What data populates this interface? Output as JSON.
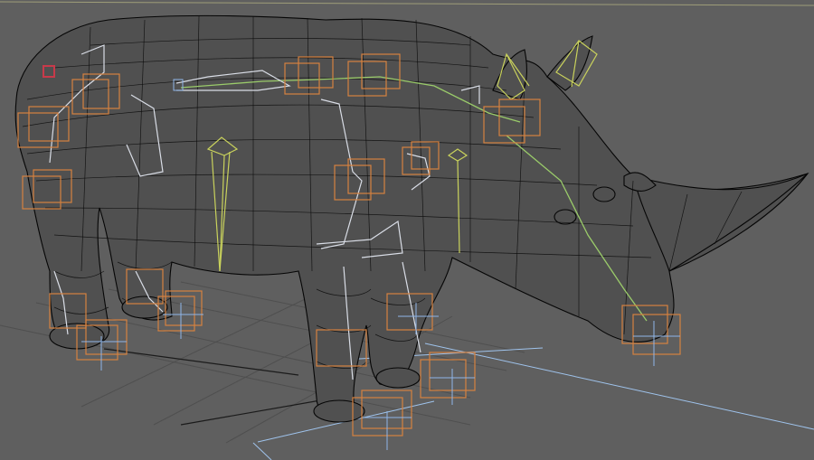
{
  "viewport": {
    "background_color": "#5f5f5f",
    "view_mode": "wireframe",
    "subject": "rhino-rig"
  },
  "colors": {
    "mesh": "#0a0a0a",
    "bones": "#d9dde6",
    "yellow_bones": "#c9d25c",
    "spine_chain": "#9acb6a",
    "controls": "#d6813f",
    "ground_guides": "#9fc3ec",
    "selection_marker": "#c83a4a"
  }
}
